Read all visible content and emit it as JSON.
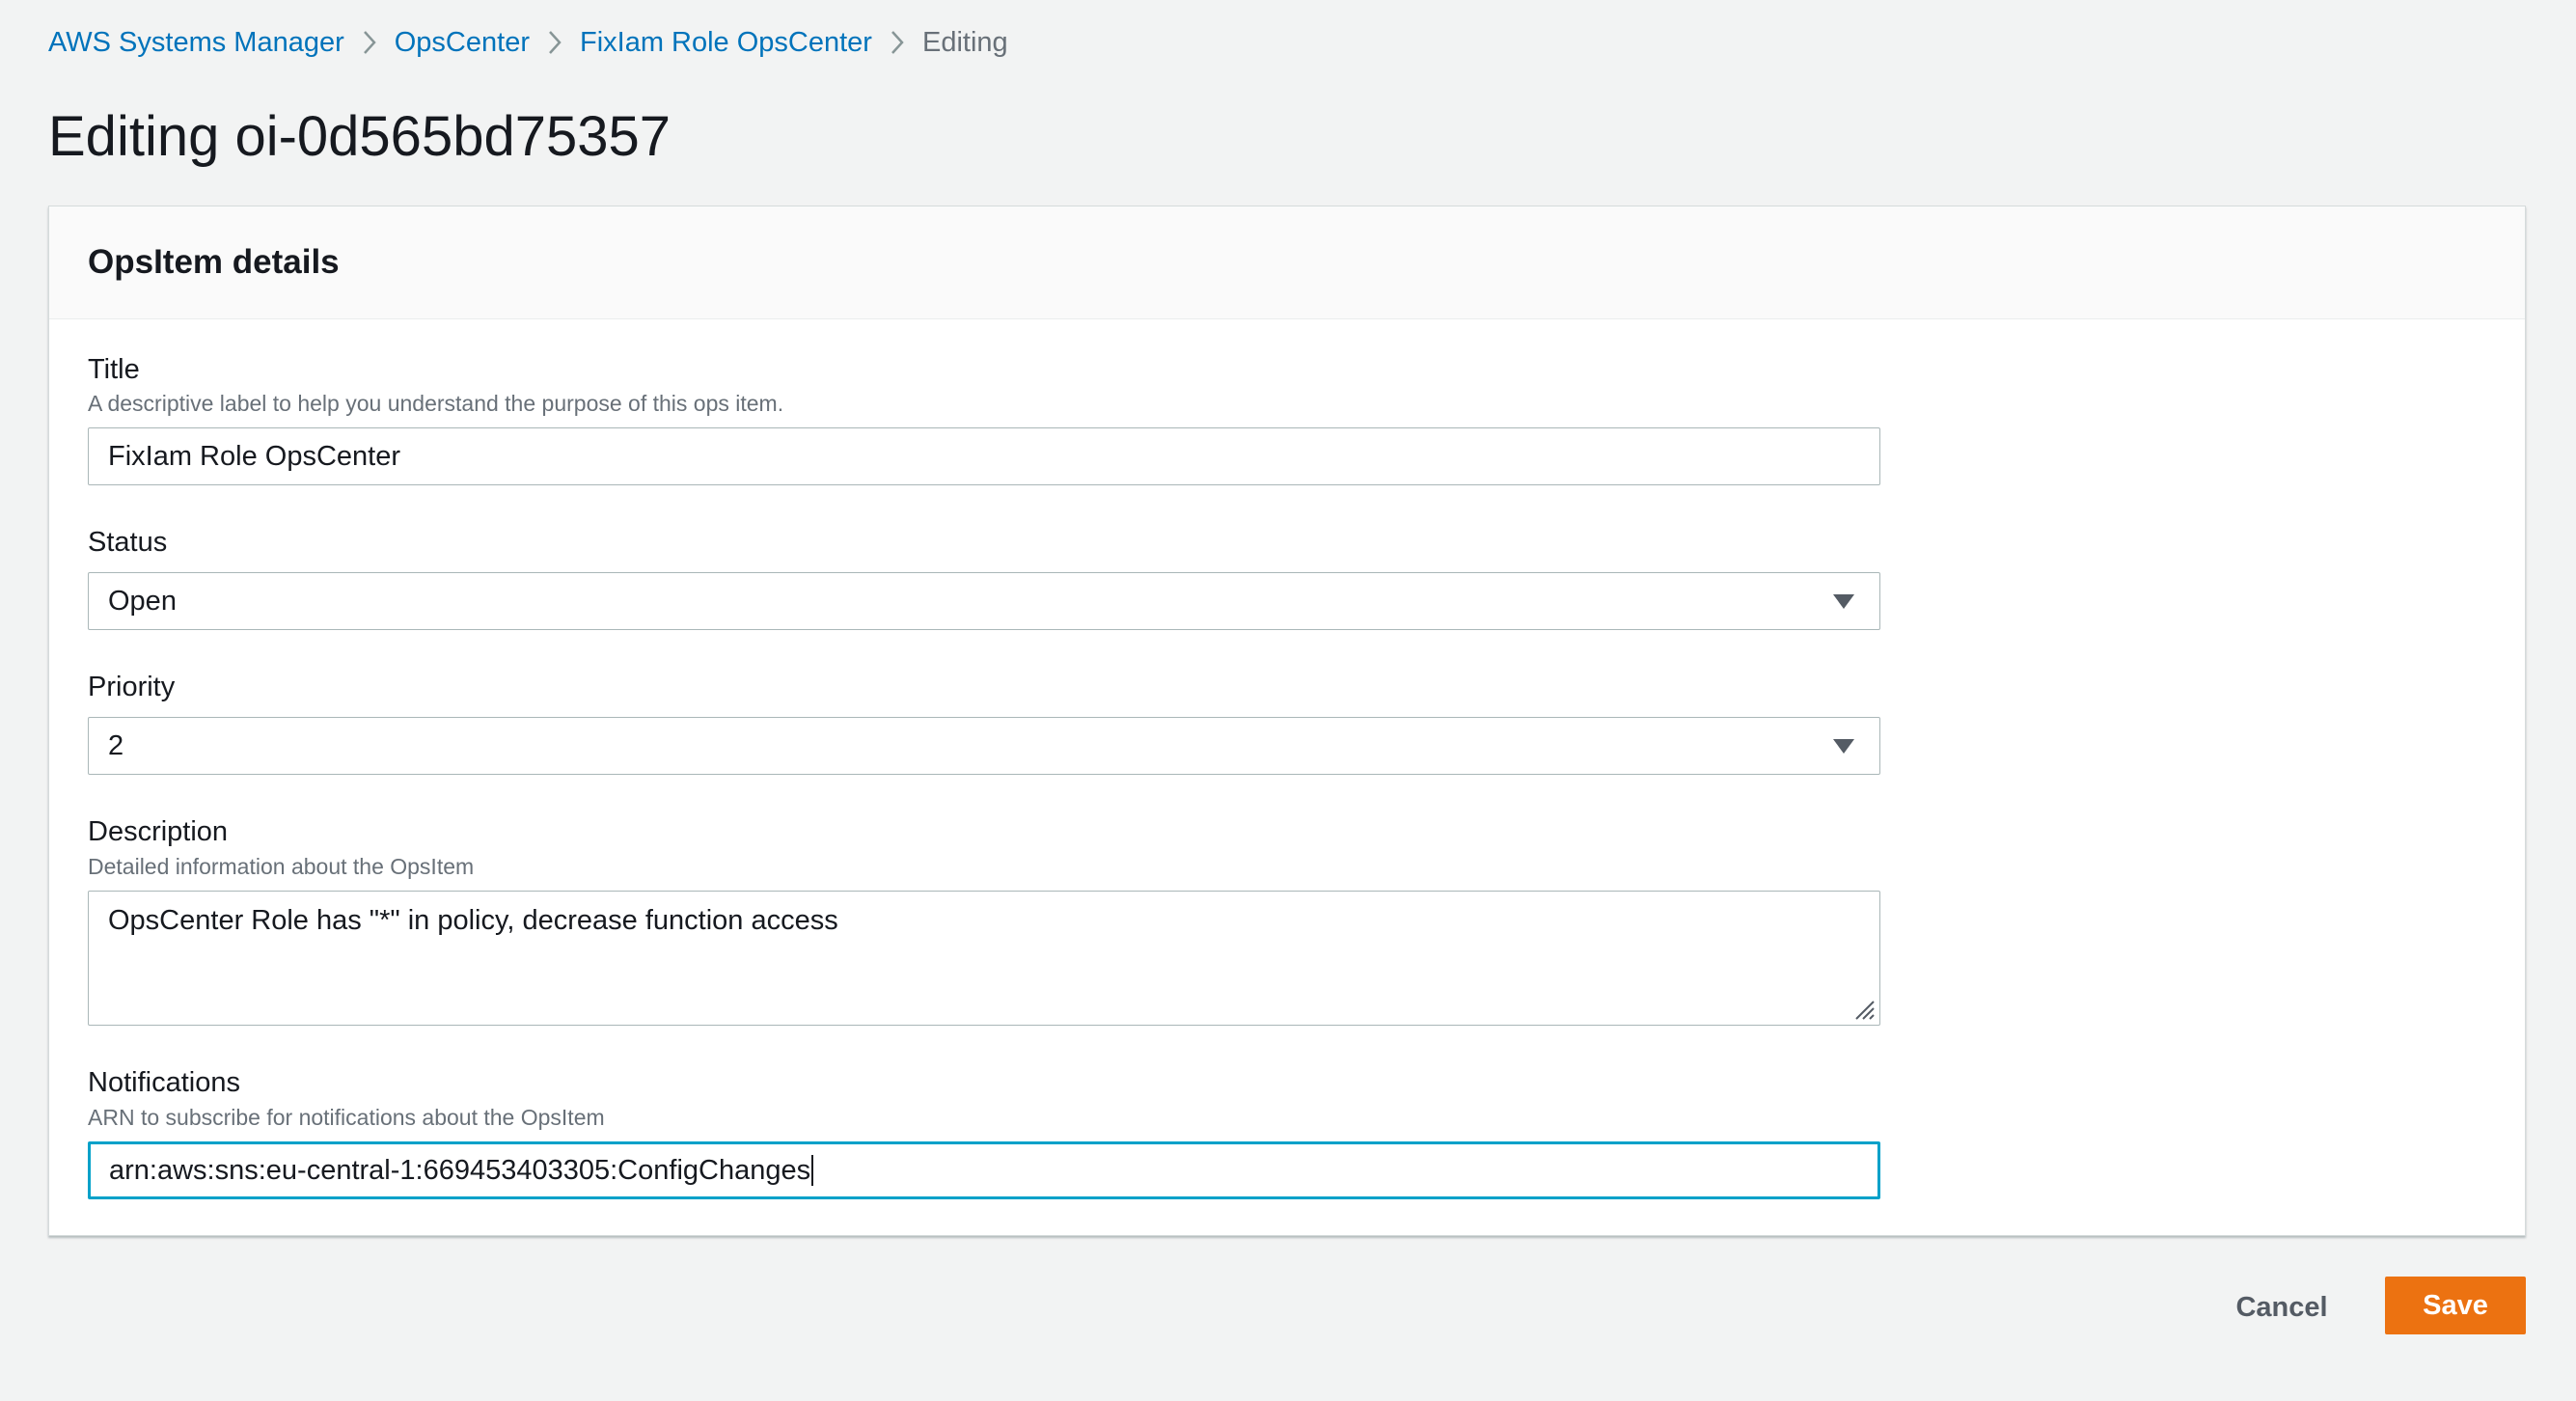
{
  "breadcrumb": {
    "items": [
      {
        "label": "AWS Systems Manager"
      },
      {
        "label": "OpsCenter"
      },
      {
        "label": "FixIam Role OpsCenter"
      },
      {
        "label": "Editing"
      }
    ]
  },
  "page": {
    "title": "Editing oi-0d565bd75357"
  },
  "panel": {
    "header": "OpsItem details"
  },
  "form": {
    "title": {
      "label": "Title",
      "description": "A descriptive label to help you understand the purpose of this ops item.",
      "value": "FixIam Role OpsCenter"
    },
    "status": {
      "label": "Status",
      "selected": "Open"
    },
    "priority": {
      "label": "Priority",
      "selected": "2"
    },
    "description": {
      "label": "Description",
      "description": "Detailed information about the OpsItem",
      "value": "OpsCenter Role has \"*\" in policy, decrease function access"
    },
    "notifications": {
      "label": "Notifications",
      "description": "ARN to subscribe for notifications about the OpsItem",
      "value": "arn:aws:sns:eu-central-1:669453403305:ConfigChanges"
    }
  },
  "actions": {
    "cancel": "Cancel",
    "save": "Save"
  },
  "colors": {
    "link": "#0073bb",
    "primary_button": "#ec7211",
    "focus_border": "#00a1c9",
    "page_background": "#f2f3f3"
  }
}
